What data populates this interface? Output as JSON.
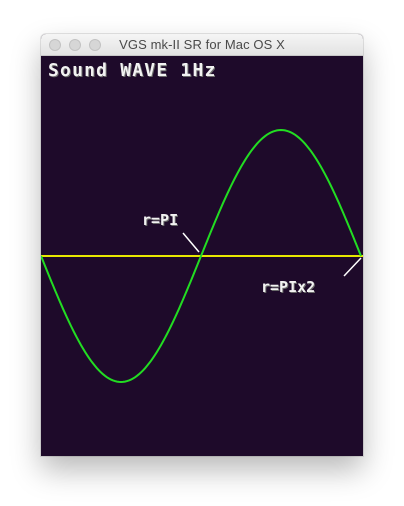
{
  "window": {
    "title": "VGS mk-II SR for Mac OS X"
  },
  "screen": {
    "heading": "Sound WAVE 1Hz",
    "labels": {
      "pi": "r=PI",
      "pi_x2": "r=PIx2"
    },
    "colors": {
      "background": "#1e0a2a",
      "wave": "#22dd22",
      "baseline": "#e8e800",
      "text": "#f2f2f2",
      "pointer": "#ffffff"
    },
    "wave_cycles": 1
  }
}
